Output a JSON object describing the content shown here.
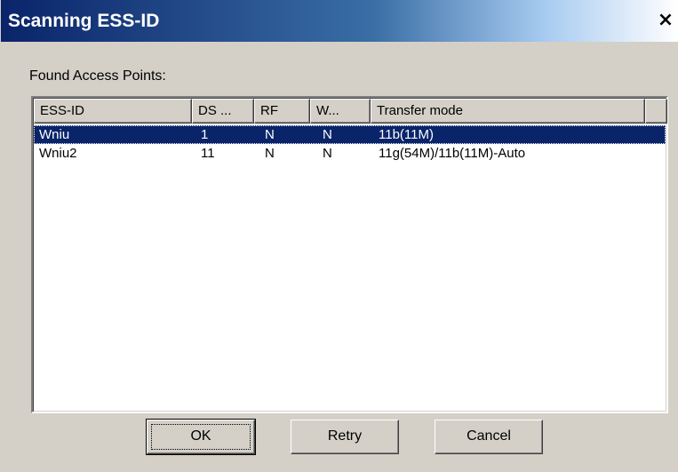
{
  "window": {
    "title": "Scanning ESS-ID",
    "close_label": "×"
  },
  "group_label": "Found Access Points:",
  "table": {
    "columns": [
      "ESS-ID",
      "DS ...",
      "RF",
      "W...",
      "Transfer mode"
    ],
    "rows": [
      {
        "ess_id": "Wniu",
        "ds": "1",
        "rf": "N",
        "w": "N",
        "transfer_mode": "11b(11M)",
        "selected": true
      },
      {
        "ess_id": "Wniu2",
        "ds": "11",
        "rf": "N",
        "w": "N",
        "transfer_mode": "11g(54M)/11b(11M)-Auto",
        "selected": false
      }
    ]
  },
  "buttons": {
    "ok": "OK",
    "retry": "Retry",
    "cancel": "Cancel"
  },
  "colors": {
    "selection": "#0a246a",
    "face": "#d4d0c8"
  }
}
